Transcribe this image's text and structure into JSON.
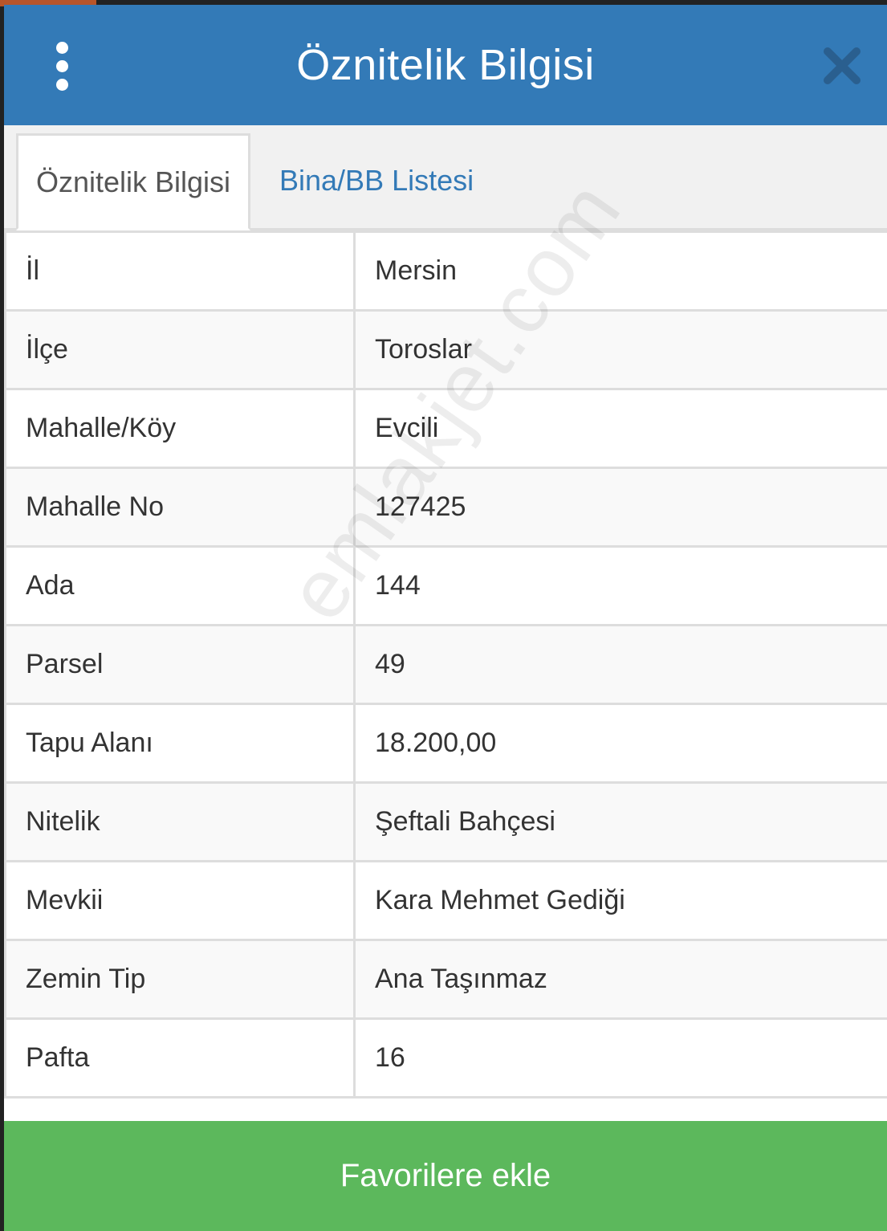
{
  "colors": {
    "header_bg": "#337ab7",
    "tab_link": "#337ab7",
    "footer_bg": "#5cb85c",
    "border": "#dddddd"
  },
  "header": {
    "title": "Öznitelik Bilgisi",
    "menu_icon": "vertical-ellipsis-icon",
    "close_icon": "close-icon"
  },
  "tabs": [
    {
      "label": "Öznitelik Bilgisi",
      "active": true
    },
    {
      "label": "Bina/BB Listesi",
      "active": false
    }
  ],
  "rows": [
    {
      "key": "İl",
      "value": "Mersin"
    },
    {
      "key": "İlçe",
      "value": "Toroslar"
    },
    {
      "key": "Mahalle/Köy",
      "value": "Evcili"
    },
    {
      "key": "Mahalle No",
      "value": "127425"
    },
    {
      "key": "Ada",
      "value": "144"
    },
    {
      "key": "Parsel",
      "value": "49"
    },
    {
      "key": "Tapu Alanı",
      "value": "18.200,00"
    },
    {
      "key": "Nitelik",
      "value": "Şeftali Bahçesi"
    },
    {
      "key": "Mevkii",
      "value": "Kara Mehmet Gediği"
    },
    {
      "key": "Zemin Tip",
      "value": "Ana Taşınmaz"
    },
    {
      "key": "Pafta",
      "value": "16"
    }
  ],
  "watermark": "emlakjet.com",
  "footer": {
    "button_label": "Favorilere ekle"
  }
}
